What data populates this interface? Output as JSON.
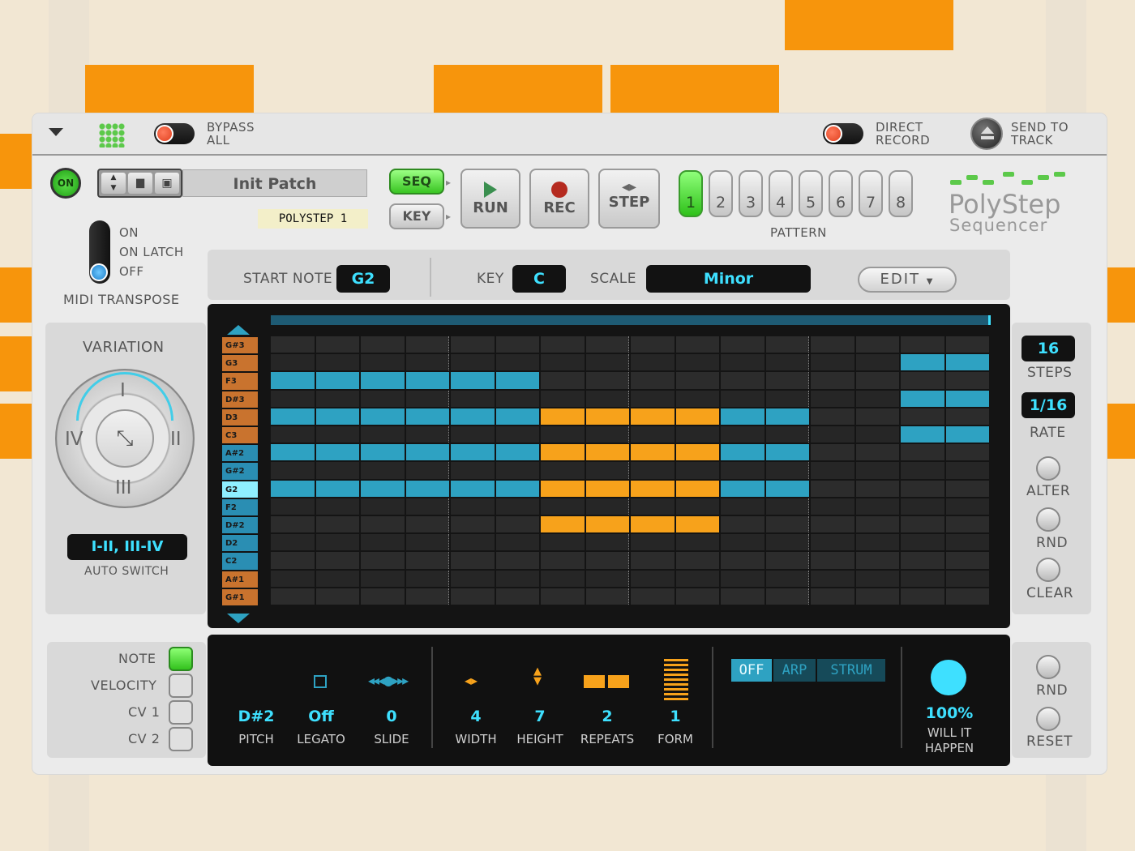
{
  "colors": {
    "accent_blue": "#2ea2c2",
    "accent_orange": "#f7a21b",
    "lcd_text": "#3ee0ff",
    "on_green": "#3dd12a",
    "bg_orange": "#f7950c"
  },
  "topbar": {
    "bypass_label": "BYPASS\nALL",
    "direct_record_label": "DIRECT\nRECORD",
    "send_to_track_label": "SEND TO\nTRACK"
  },
  "icons": {
    "menu": "chevron-down-icon",
    "dots": "grid-dots-icon",
    "send": "eject-icon"
  },
  "header": {
    "on_label": "ON",
    "patch_name": "Init Patch",
    "device_tag": "POLYSTEP 1",
    "seq_label": "SEQ",
    "key_label": "KEY",
    "run_label": "RUN",
    "rec_label": "REC",
    "step_label": "STEP"
  },
  "pattern": {
    "label": "PATTERN",
    "buttons": [
      "1",
      "2",
      "3",
      "4",
      "5",
      "6",
      "7",
      "8"
    ],
    "selected": "1"
  },
  "logo": {
    "line1": "PolyStep",
    "line2": "Sequencer"
  },
  "midi_transpose": {
    "options": [
      "ON",
      "ON LATCH",
      "OFF"
    ],
    "selected": "OFF",
    "label": "MIDI TRANSPOSE"
  },
  "toolbar": {
    "start_note_label": "START NOTE",
    "start_note_value": "G2",
    "key_label": "KEY",
    "key_value": "C",
    "scale_label": "SCALE",
    "scale_value": "Minor",
    "edit_label": "EDIT"
  },
  "variation": {
    "title": "VARIATION",
    "dirs": {
      "top": "I",
      "right": "II",
      "bottom": "III",
      "left": "IV"
    },
    "auto_switch_value": "I-II, III-IV",
    "auto_switch_label": "AUTO SWITCH"
  },
  "notes": [
    "G#3",
    "G3",
    "F3",
    "D#3",
    "D3",
    "C3",
    "A#2",
    "G#2",
    "G2",
    "F2",
    "D#2",
    "D2",
    "C2",
    "A#1",
    "G#1"
  ],
  "grid": {
    "steps": 16,
    "highlight_note": "G2",
    "cell_ranges": [
      {
        "note": "F3",
        "from": 0,
        "to": 5,
        "color": "blue"
      },
      {
        "note": "D3",
        "from": 0,
        "to": 5,
        "color": "blue"
      },
      {
        "note": "A#2",
        "from": 0,
        "to": 5,
        "color": "blue"
      },
      {
        "note": "G2",
        "from": 0,
        "to": 5,
        "color": "blue"
      },
      {
        "note": "D3",
        "from": 6,
        "to": 9,
        "color": "orange"
      },
      {
        "note": "A#2",
        "from": 6,
        "to": 9,
        "color": "orange"
      },
      {
        "note": "G2",
        "from": 6,
        "to": 9,
        "color": "orange"
      },
      {
        "note": "D#2",
        "from": 6,
        "to": 9,
        "color": "orange"
      },
      {
        "note": "D3",
        "from": 10,
        "to": 11,
        "color": "blue"
      },
      {
        "note": "A#2",
        "from": 10,
        "to": 11,
        "color": "blue"
      },
      {
        "note": "G2",
        "from": 10,
        "to": 11,
        "color": "blue"
      },
      {
        "note": "G3",
        "from": 14,
        "to": 15,
        "color": "blue"
      },
      {
        "note": "D#3",
        "from": 14,
        "to": 15,
        "color": "blue"
      },
      {
        "note": "C3",
        "from": 14,
        "to": 15,
        "color": "blue"
      }
    ]
  },
  "right": {
    "steps_value": "16",
    "steps_label": "STEPS",
    "rate_value": "1/16",
    "rate_label": "RATE",
    "alter_label": "ALTER",
    "rnd_label": "RND",
    "clear_label": "CLEAR",
    "rnd2_label": "RND",
    "reset_label": "RESET"
  },
  "lanes": {
    "items": [
      "NOTE",
      "VELOCITY",
      "CV 1",
      "CV 2"
    ],
    "selected": "NOTE"
  },
  "bottom": {
    "pitch_value": "D#2",
    "pitch_label": "PITCH",
    "legato_value": "Off",
    "legato_label": "LEGATO",
    "slide_value": "0",
    "slide_label": "SLIDE",
    "width_value": "4",
    "width_label": "WIDTH",
    "height_value": "7",
    "height_label": "HEIGHT",
    "repeats_value": "2",
    "repeats_label": "REPEATS",
    "form_value": "1",
    "form_label": "FORM",
    "mode_off": "OFF",
    "mode_arp": "ARP",
    "mode_strum": "STRUM",
    "prob_value": "100%",
    "prob_label": "WILL IT\nHAPPEN"
  }
}
